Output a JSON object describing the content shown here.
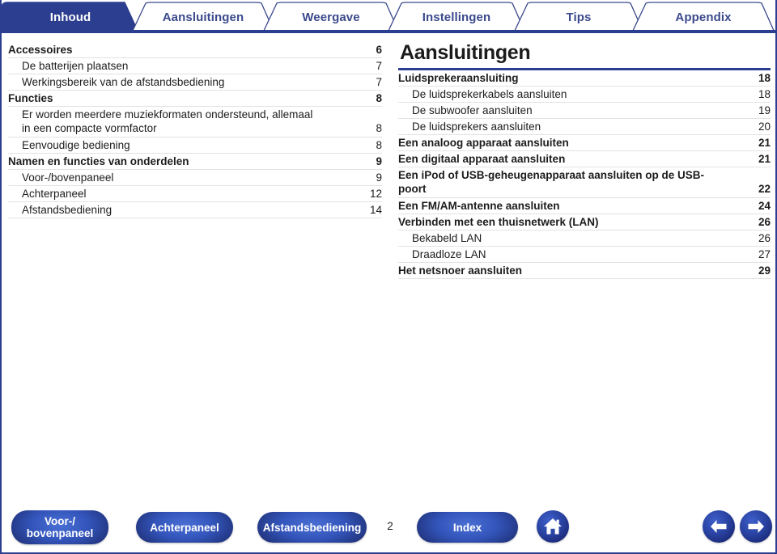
{
  "tabs": [
    {
      "label": "Inhoud",
      "active": true
    },
    {
      "label": "Aansluitingen",
      "active": false
    },
    {
      "label": "Weergave",
      "active": false
    },
    {
      "label": "Instellingen",
      "active": false
    },
    {
      "label": "Tips",
      "active": false
    },
    {
      "label": "Appendix",
      "active": false
    }
  ],
  "left_column": {
    "entries": [
      {
        "title": "Accessoires",
        "page": "6",
        "level": 1
      },
      {
        "title": "De batterijen plaatsen",
        "page": "7",
        "level": 2
      },
      {
        "title": "Werkingsbereik van de afstandsbediening",
        "page": "7",
        "level": 2
      },
      {
        "title": "Functies",
        "page": "8",
        "level": 1
      },
      {
        "title": "Er worden meerdere muziekformaten ondersteund, allemaal in een compacte vormfactor",
        "page": "8",
        "level": 2
      },
      {
        "title": "Eenvoudige bediening",
        "page": "8",
        "level": 2
      },
      {
        "title": "Namen en functies van onderdelen",
        "page": "9",
        "level": 1
      },
      {
        "title": "Voor-/bovenpaneel",
        "page": "9",
        "level": 2
      },
      {
        "title": "Achterpaneel",
        "page": "12",
        "level": 2
      },
      {
        "title": "Afstandsbediening",
        "page": "14",
        "level": 2
      }
    ]
  },
  "right_column": {
    "title": "Aansluitingen",
    "entries": [
      {
        "title": "Luidsprekeraansluiting",
        "page": "18",
        "level": 1
      },
      {
        "title": "De luidsprekerkabels aansluiten",
        "page": "18",
        "level": 2
      },
      {
        "title": "De subwoofer aansluiten",
        "page": "19",
        "level": 2
      },
      {
        "title": "De luidsprekers aansluiten",
        "page": "20",
        "level": 2
      },
      {
        "title": "Een analoog apparaat aansluiten",
        "page": "21",
        "level": 1
      },
      {
        "title": "Een digitaal apparaat aansluiten",
        "page": "21",
        "level": 1
      },
      {
        "title": "Een iPod of USB-geheugenapparaat aansluiten op de USB-poort",
        "page": "22",
        "level": 1
      },
      {
        "title": "Een FM/AM-antenne aansluiten",
        "page": "24",
        "level": 1
      },
      {
        "title": "Verbinden met een thuisnetwerk (LAN)",
        "page": "26",
        "level": 1
      },
      {
        "title": "Bekabeld LAN",
        "page": "26",
        "level": 2
      },
      {
        "title": "Draadloze LAN",
        "page": "27",
        "level": 2
      },
      {
        "title": "Het netsnoer aansluiten",
        "page": "29",
        "level": 1
      }
    ]
  },
  "footer": {
    "buttons": [
      {
        "id": "voor",
        "label": "Voor-/\nbovenpaneel"
      },
      {
        "id": "achter",
        "label": "Achterpaneel"
      },
      {
        "id": "afstand",
        "label": "Afstandsbediening"
      },
      {
        "id": "index",
        "label": "Index"
      }
    ],
    "page_number": "2",
    "icons": {
      "home": "home-icon",
      "prev": "arrow-left-icon",
      "next": "arrow-right-icon"
    }
  },
  "colors": {
    "tab_active_bg": "#2c3e8f",
    "tab_label": "#3b4a8c",
    "rule": "#2c3e8f",
    "separator": "#e3e3e3",
    "text": "#1c1c1c"
  }
}
